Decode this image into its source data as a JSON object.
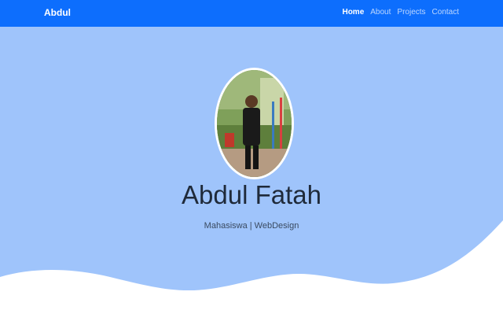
{
  "navbar": {
    "brand": "Abdul",
    "links": [
      {
        "label": "Home"
      },
      {
        "label": "About"
      },
      {
        "label": "Projects"
      },
      {
        "label": "Contact"
      }
    ]
  },
  "hero": {
    "name": "Abdul Fatah",
    "subtitle": "Mahasiswa | WebDesign"
  },
  "colors": {
    "navbar": "#0d6efd",
    "hero_bg": "#9fc4fb",
    "wave": "#ffffff"
  }
}
